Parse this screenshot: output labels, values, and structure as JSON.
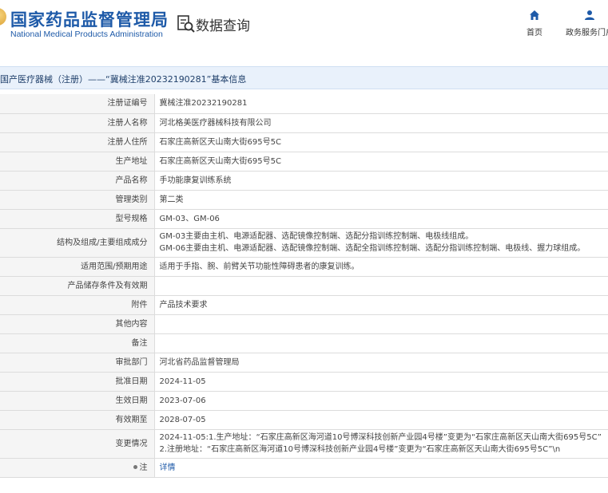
{
  "header": {
    "org_cn": "国家药品监督管理局",
    "org_en": "National Medical Products Administration",
    "system_title": "数据查询",
    "nav": [
      {
        "label": "首页",
        "icon": "home-icon"
      },
      {
        "label": "政务服务门户",
        "icon": "user-icon"
      }
    ]
  },
  "page_title": "国产医疗器械（注册）——“冀械注准20232190281”基本信息",
  "fields": [
    {
      "label": "注册证编号",
      "value": "冀械注准20232190281"
    },
    {
      "label": "注册人名称",
      "value": "河北格美医疗器械科技有限公司"
    },
    {
      "label": "注册人住所",
      "value": "石家庄高新区天山南大街695号5C"
    },
    {
      "label": "生产地址",
      "value": "石家庄高新区天山南大街695号5C"
    },
    {
      "label": "产品名称",
      "value": "手功能康复训练系统"
    },
    {
      "label": "管理类别",
      "value": "第二类"
    },
    {
      "label": "型号规格",
      "value": "GM-03、GM-06"
    },
    {
      "label": "结构及组成/主要组成成分",
      "value_line1": "GM-03主要由主机、电源适配器、选配镜像控制端、选配分指训练控制端、电极线组成。",
      "value_line2": "GM-06主要由主机、电源适配器、选配镜像控制端、选配全指训练控制端、选配分指训练控制端、电极线、握力球组成。"
    },
    {
      "label": "适用范围/预期用途",
      "value": "适用于手指、腕、前臂关节功能性障碍患者的康复训练。"
    },
    {
      "label": "产品储存条件及有效期",
      "value": ""
    },
    {
      "label": "附件",
      "value": "产品技术要求"
    },
    {
      "label": "其他内容",
      "value": ""
    },
    {
      "label": "备注",
      "value": ""
    },
    {
      "label": "审批部门",
      "value": "河北省药品监督管理局"
    },
    {
      "label": "批准日期",
      "value": "2024-11-05"
    },
    {
      "label": "生效日期",
      "value": "2023-07-06"
    },
    {
      "label": "有效期至",
      "value": "2028-07-05"
    },
    {
      "label": "变更情况",
      "value_line1": "2024-11-05:1.生产地址：“石家庄高新区海河道10号博深科技创新产业园4号楼”变更为“石家庄高新区天山南大街695号5C”",
      "value_line2": "2.注册地址：“石家庄高新区海河道10号博深科技创新产业园4号楼”变更为“石家庄高新区天山南大街695号5C”\\n"
    },
    {
      "label": "注",
      "value": "详情"
    }
  ]
}
